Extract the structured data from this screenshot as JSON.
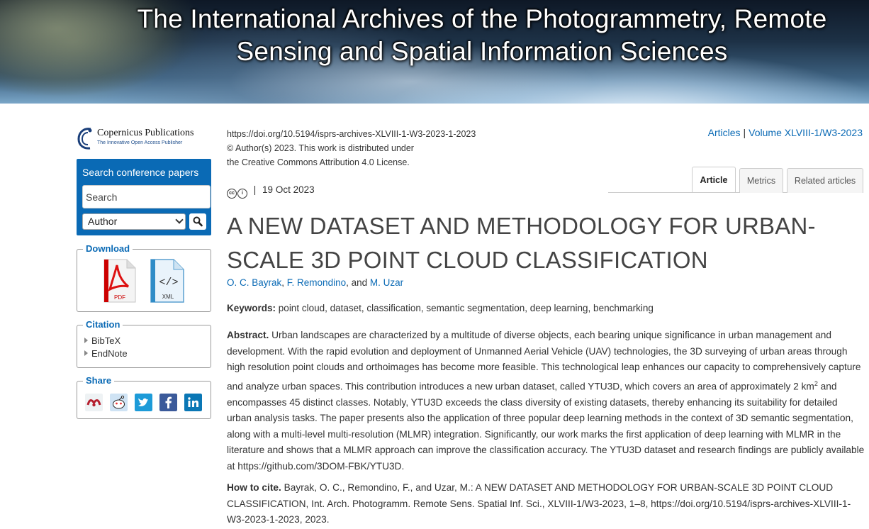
{
  "banner": {
    "title_line1": "The International Archives of the Photogrammetry, Remote",
    "title_line2": "Sensing and Spatial Information Sciences"
  },
  "logo": {
    "name": "Copernicus Publications",
    "tagline": "The Innovative Open Access Publisher"
  },
  "search": {
    "header": "Search conference papers",
    "placeholder": "Search",
    "field_selected": "Author"
  },
  "download": {
    "legend": "Download",
    "pdf_label": "PDF",
    "xml_label": "XML"
  },
  "citation": {
    "legend": "Citation",
    "items": [
      "BibTeX",
      "EndNote"
    ]
  },
  "share": {
    "legend": "Share",
    "icons": [
      "mendeley-icon",
      "reddit-icon",
      "twitter-icon",
      "facebook-icon",
      "linkedin-icon"
    ]
  },
  "meta": {
    "doi": "https://doi.org/10.5194/isprs-archives-XLVIII-1-W3-2023-1-2023",
    "copyright": "© Author(s) 2023. This work is distributed under",
    "license": "the Creative Commons Attribution 4.0 License."
  },
  "breadcrumb": {
    "articles": "Articles",
    "separator": "|",
    "volume": "Volume XLVIII-1/W3-2023"
  },
  "tabs": [
    "Article",
    "Metrics",
    "Related articles"
  ],
  "license_line": {
    "separator": "|",
    "date": "19 Oct 2023"
  },
  "article": {
    "title_line1": "A NEW DATASET AND METHODOLOGY FOR URBAN-",
    "title_line2": "SCALE 3D POINT CLOUD CLASSIFICATION",
    "authors": [
      "O. C. Bayrak",
      "F. Remondino",
      "M. Uzar"
    ],
    "authors_sep1": ", ",
    "authors_sep2": ", and ",
    "keywords_label": "Keywords:",
    "keywords": "point cloud, dataset, classification, semantic segmentation, deep learning, benchmarking",
    "abstract_label": "Abstract.",
    "abstract_part1": "Urban landscapes are characterized by a multitude of diverse objects, each bearing unique significance in urban management and development. With the rapid evolution and deployment of Unmanned Aerial Vehicle (UAV) technologies, the 3D surveying of urban areas through high resolution point clouds and orthoimages has become more feasible. This technological leap enhances our capacity to comprehensively capture and analyze urban spaces. This contribution introduces a new urban dataset, called YTU3D, which covers an area of approximately 2 km",
    "abstract_sup": "2",
    "abstract_part2": " and encompasses 45 distinct classes. Notably, YTU3D exceeds the class diversity of existing datasets, thereby enhancing its suitability for detailed urban analysis tasks. The paper presents also the application of three popular deep learning methods in the context of 3D semantic segmentation, along with a multi-level multi-resolution (MLMR) integration. Significantly, our work marks the first application of deep learning with MLMR in the literature and shows that a MLMR approach can improve the classification accuracy. The YTU3D dataset and research findings are publicly available at https://github.com/3DOM-FBK/YTU3D.",
    "cite_label": "How to cite.",
    "cite_text": "Bayrak, O. C., Remondino, F., and Uzar, M.: A NEW DATASET AND METHODOLOGY FOR URBAN-SCALE 3D POINT CLOUD CLASSIFICATION, Int. Arch. Photogramm. Remote Sens. Spatial Inf. Sci., XLVIII-1/W3-2023, 1–8, https://doi.org/10.5194/isprs-archives-XLVIII-1-W3-2023-1-2023, 2023."
  },
  "colors": {
    "link_blue": "#0a6ab5",
    "text": "#333333",
    "title_gray": "#444444"
  }
}
